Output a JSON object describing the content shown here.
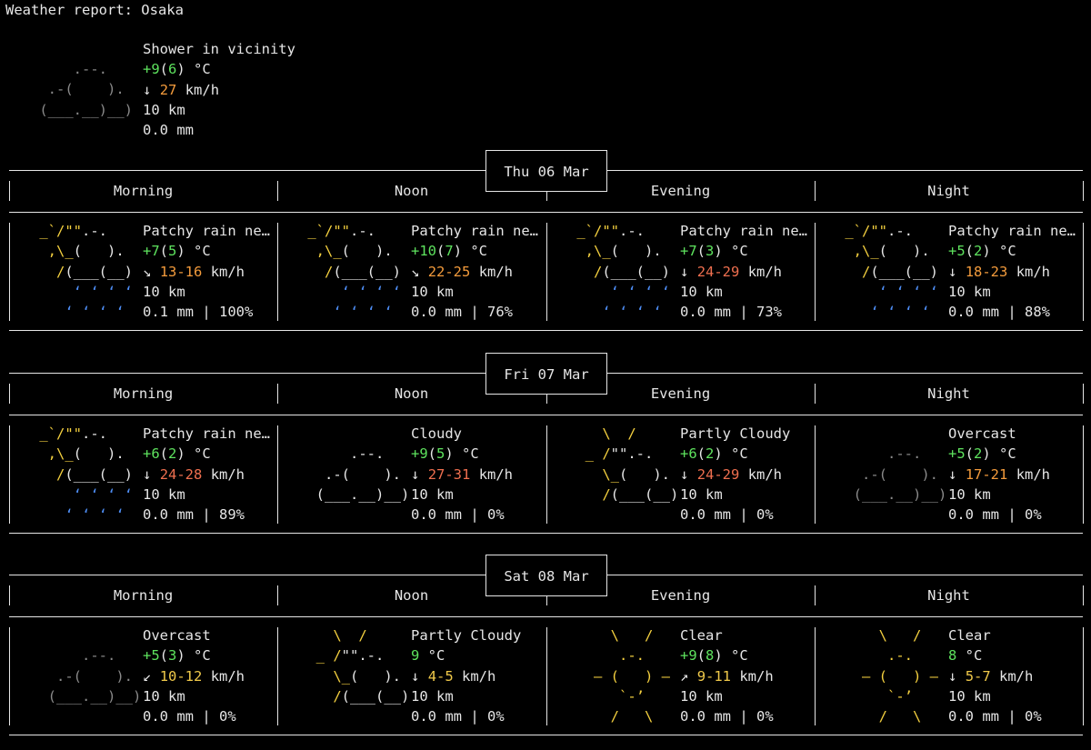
{
  "title": "Weather report: Osaka",
  "colors": {
    "sun": "#f4d03f",
    "cloud_dark": "#8a8a8a",
    "rain": "#4f8ff7",
    "temp_green": "#5ee35e",
    "wind_yellow": "#f0c94a",
    "wind_orange": "#f39b3c"
  },
  "current": {
    "condition": "Shower in vicinity",
    "temp": "+9",
    "feels": "6",
    "temp_unit": "°C",
    "wind_arrow": "↓",
    "wind": "27",
    "wind_unit": "km/h",
    "visibility": "10 km",
    "precip": "0.0 mm",
    "icon": "cloud-icon"
  },
  "days": [
    {
      "date": "Thu 06 Mar",
      "periods": [
        {
          "name": "Morning",
          "icon": "patchy-rain-icon",
          "condition": "Patchy rain ne…",
          "temp": "+7",
          "feels": "5",
          "wind_arrow": "↘",
          "wind": "13-16",
          "wind_unit": "km/h",
          "visibility": "10 km",
          "precip": "0.1 mm | 100%"
        },
        {
          "name": "Noon",
          "icon": "patchy-rain-icon",
          "condition": "Patchy rain ne…",
          "temp": "+10",
          "feels": "7",
          "wind_arrow": "↘",
          "wind": "22-25",
          "wind_unit": "km/h",
          "visibility": "10 km",
          "precip": "0.0 mm | 76%"
        },
        {
          "name": "Evening",
          "icon": "patchy-rain-icon",
          "condition": "Patchy rain ne…",
          "temp": "+7",
          "feels": "3",
          "wind_arrow": "↓",
          "wind": "24-29",
          "wind_unit": "km/h",
          "visibility": "10 km",
          "precip": "0.0 mm | 73%"
        },
        {
          "name": "Night",
          "icon": "patchy-rain-icon",
          "condition": "Patchy rain ne…",
          "temp": "+5",
          "feels": "2",
          "wind_arrow": "↓",
          "wind": "18-23",
          "wind_unit": "km/h",
          "visibility": "10 km",
          "precip": "0.0 mm | 88%"
        }
      ]
    },
    {
      "date": "Fri 07 Mar",
      "periods": [
        {
          "name": "Morning",
          "icon": "patchy-rain-icon",
          "condition": "Patchy rain ne…",
          "temp": "+6",
          "feels": "2",
          "wind_arrow": "↓",
          "wind": "24-28",
          "wind_unit": "km/h",
          "visibility": "10 km",
          "precip": "0.0 mm | 89%"
        },
        {
          "name": "Noon",
          "icon": "cloudy-icon",
          "condition": "Cloudy",
          "temp": "+9",
          "feels": "5",
          "wind_arrow": "↓",
          "wind": "27-31",
          "wind_unit": "km/h",
          "visibility": "10 km",
          "precip": "0.0 mm | 0%"
        },
        {
          "name": "Evening",
          "icon": "partly-cloudy-icon",
          "condition": "Partly Cloudy",
          "temp": "+6",
          "feels": "2",
          "wind_arrow": "↓",
          "wind": "24-29",
          "wind_unit": "km/h",
          "visibility": "10 km",
          "precip": "0.0 mm | 0%"
        },
        {
          "name": "Night",
          "icon": "overcast-icon",
          "condition": "Overcast",
          "temp": "+5",
          "feels": "2",
          "wind_arrow": "↓",
          "wind": "17-21",
          "wind_unit": "km/h",
          "visibility": "10 km",
          "precip": "0.0 mm | 0%"
        }
      ]
    },
    {
      "date": "Sat 08 Mar",
      "periods": [
        {
          "name": "Morning",
          "icon": "overcast-icon",
          "condition": "Overcast",
          "temp": "+5",
          "feels": "3",
          "wind_arrow": "↙",
          "wind": "10-12",
          "wind_unit": "km/h",
          "visibility": "10 km",
          "precip": "0.0 mm | 0%"
        },
        {
          "name": "Noon",
          "icon": "partly-cloudy-icon",
          "condition": "Partly Cloudy",
          "temp": "9",
          "feels": "",
          "wind_arrow": "↓",
          "wind": "4-5",
          "wind_unit": "km/h",
          "visibility": "10 km",
          "precip": "0.0 mm | 0%"
        },
        {
          "name": "Evening",
          "icon": "clear-icon",
          "condition": "Clear",
          "temp": "+9",
          "feels": "8",
          "wind_arrow": "↗",
          "wind": "9-11",
          "wind_unit": "km/h",
          "visibility": "10 km",
          "precip": "0.0 mm | 0%"
        },
        {
          "name": "Night",
          "icon": "clear-icon",
          "condition": "Clear",
          "temp": "8",
          "feels": "",
          "wind_arrow": "↓",
          "wind": "5-7",
          "wind_unit": "km/h",
          "visibility": "10 km",
          "precip": "0.0 mm | 0%"
        }
      ]
    }
  ]
}
